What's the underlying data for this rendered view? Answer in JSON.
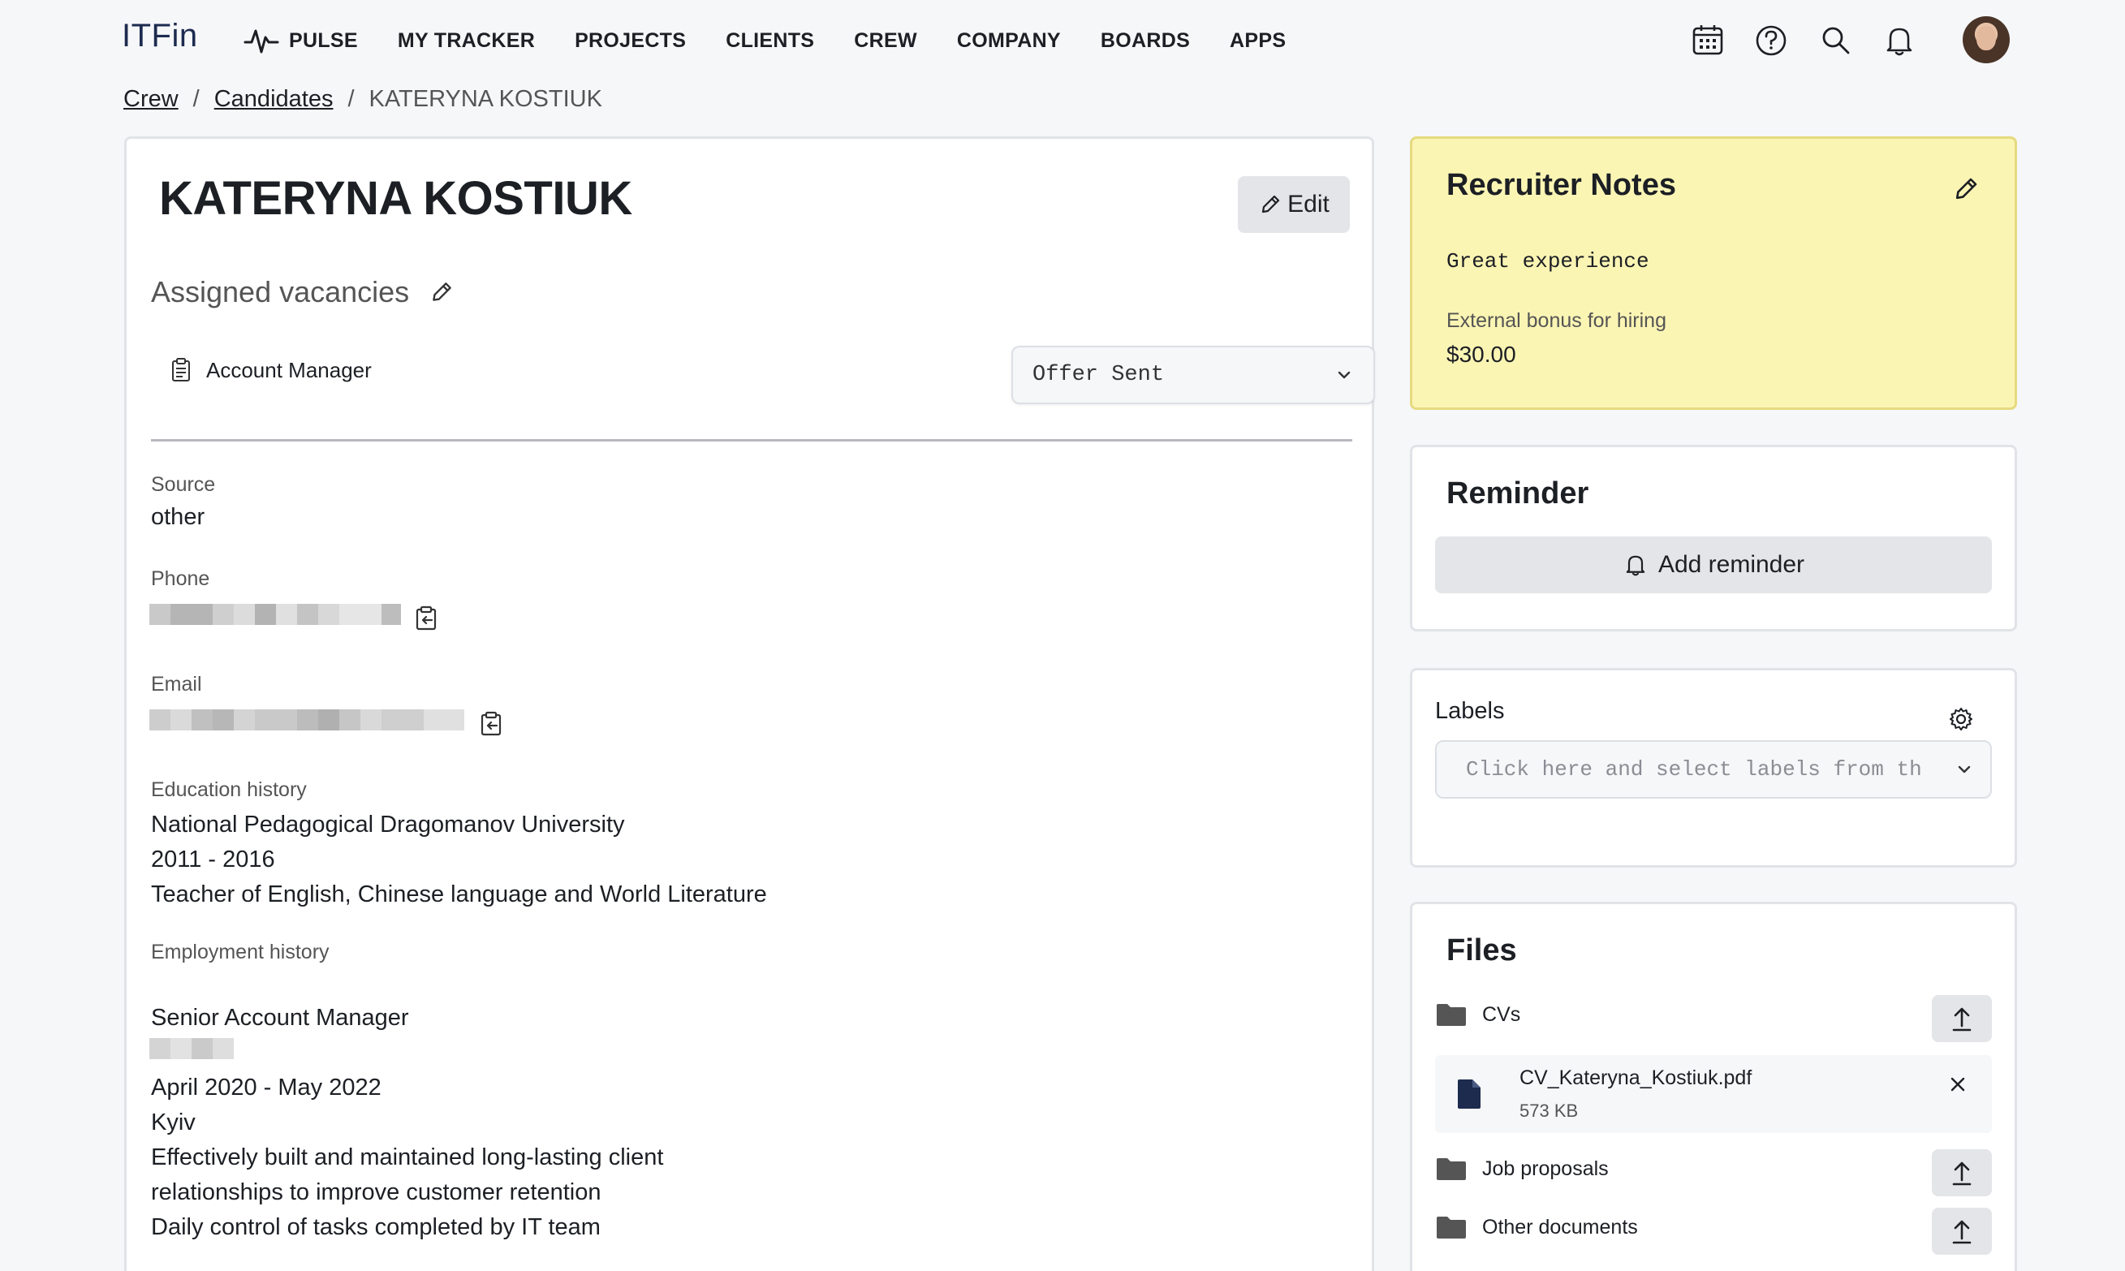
{
  "app": {
    "logo": "ITFin"
  },
  "nav": {
    "items": [
      {
        "label": "PULSE",
        "icon": "pulse-icon"
      },
      {
        "label": "MY TRACKER"
      },
      {
        "label": "PROJECTS"
      },
      {
        "label": "CLIENTS"
      },
      {
        "label": "CREW"
      },
      {
        "label": "COMPANY"
      },
      {
        "label": "BOARDS"
      },
      {
        "label": "APPS"
      }
    ],
    "right_icons": [
      "calendar-icon",
      "help-icon",
      "search-icon",
      "bell-icon",
      "avatar"
    ]
  },
  "breadcrumb": {
    "items": [
      "Crew",
      "Candidates"
    ],
    "separator": "/",
    "current": "KATERYNA KOSTIUK"
  },
  "candidate": {
    "name": "KATERYNA KOSTIUK",
    "edit_label": "Edit",
    "assigned_vacancies_label": "Assigned vacancies",
    "vacancy": {
      "title": "Account Manager",
      "status": "Offer Sent"
    },
    "source": {
      "label": "Source",
      "value": "other"
    },
    "phone": {
      "label": "Phone"
    },
    "email": {
      "label": "Email"
    },
    "education": {
      "label": "Education history",
      "lines": [
        "National Pedagogical Dragomanov University",
        "2011 - 2016",
        "Teacher of English, Chinese language and World Literature"
      ]
    },
    "employment": {
      "label": "Employment history",
      "position": "Senior Account Manager",
      "lines": [
        "April 2020 - May 2022",
        "Kyiv",
        "Effectively built and maintained long-lasting client",
        "relationships to improve customer retention",
        "Daily control of tasks completed by IT team"
      ]
    }
  },
  "recruiter_notes": {
    "title": "Recruiter Notes",
    "text": "Great experience",
    "bonus_label": "External bonus for hiring",
    "bonus_value": "$30.00"
  },
  "reminder": {
    "title": "Reminder",
    "button_label": "Add reminder"
  },
  "labels": {
    "title": "Labels",
    "placeholder": "Click here and select labels from the"
  },
  "files": {
    "title": "Files",
    "folders": {
      "cvs": "CVs",
      "job_proposals": "Job proposals",
      "other_documents": "Other documents"
    },
    "cv_file": {
      "name": "CV_Kateryna_Kostiuk.pdf",
      "size": "573 KB"
    }
  },
  "colors": {
    "notes_bg": "#fbf5b4",
    "notes_border": "#e6da80",
    "logo": "#1d2b4f",
    "file_icon": "#1d2b4f"
  }
}
